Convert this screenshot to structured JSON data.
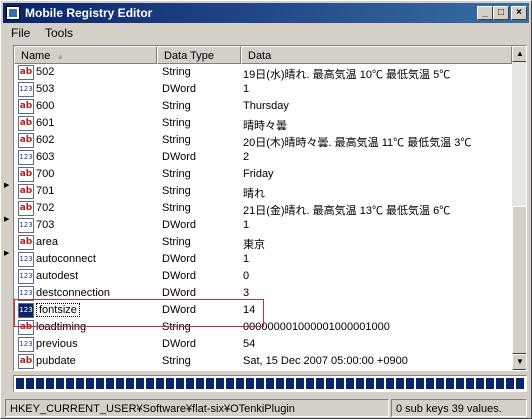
{
  "window": {
    "title": "Mobile Registry Editor",
    "min_glyph": "_",
    "max_glyph": "□",
    "close_glyph": "×"
  },
  "menu": {
    "file": "File",
    "tools": "Tools"
  },
  "columns": {
    "name": "Name",
    "type": "Data Type",
    "data": "Data"
  },
  "rows": [
    {
      "name": "502",
      "type": "String",
      "data": "19日(水)晴れ. 最高気温 10℃ 最低気温 5℃",
      "icon": "string-value-icon"
    },
    {
      "name": "503",
      "type": "DWord",
      "data": "1",
      "icon": "dword-value-icon"
    },
    {
      "name": "600",
      "type": "String",
      "data": "Thursday",
      "icon": "string-value-icon"
    },
    {
      "name": "601",
      "type": "String",
      "data": "晴時々曇",
      "icon": "string-value-icon"
    },
    {
      "name": "602",
      "type": "String",
      "data": "20日(木)晴時々曇. 最高気温 11℃ 最低気温 3℃",
      "icon": "string-value-icon"
    },
    {
      "name": "603",
      "type": "DWord",
      "data": "2",
      "icon": "dword-value-icon"
    },
    {
      "name": "700",
      "type": "String",
      "data": "Friday",
      "icon": "string-value-icon"
    },
    {
      "name": "701",
      "type": "String",
      "data": "晴れ",
      "icon": "string-value-icon"
    },
    {
      "name": "702",
      "type": "String",
      "data": "21日(金)晴れ. 最高気温 13℃ 最低気温 6℃",
      "icon": "string-value-icon"
    },
    {
      "name": "703",
      "type": "DWord",
      "data": "1",
      "icon": "dword-value-icon"
    },
    {
      "name": "area",
      "type": "String",
      "data": "東京",
      "icon": "string-value-icon"
    },
    {
      "name": "autoconnect",
      "type": "DWord",
      "data": "1",
      "icon": "dword-value-icon"
    },
    {
      "name": "autodest",
      "type": "DWord",
      "data": "0",
      "icon": "dword-value-icon"
    },
    {
      "name": "destconnection",
      "type": "DWord",
      "data": "3",
      "icon": "dword-value-icon"
    },
    {
      "name": "fontsize",
      "type": "DWord",
      "data": "14",
      "icon": "dword-value-icon",
      "selected": true
    },
    {
      "name": "loadtiming",
      "type": "String",
      "data": "000000001000001000001000",
      "icon": "string-value-icon"
    },
    {
      "name": "previous",
      "type": "DWord",
      "data": "54",
      "icon": "dword-value-icon"
    },
    {
      "name": "pubdate",
      "type": "String",
      "data": "Sat, 15 Dec 2007 05:00:00 +0900",
      "icon": "string-value-icon"
    }
  ],
  "icon_glyphs": {
    "string": "ab",
    "dword": "123"
  },
  "status": {
    "path": "HKEY_CURRENT_USER¥Software¥flat-six¥OTenkiPlugin",
    "count": "0 sub keys 39 values."
  },
  "progress": {
    "fraction": 1.0
  },
  "colors": {
    "titlebar_start": "#0a246a",
    "titlebar_end": "#3a6ea5",
    "highlight": "#c0303a"
  }
}
